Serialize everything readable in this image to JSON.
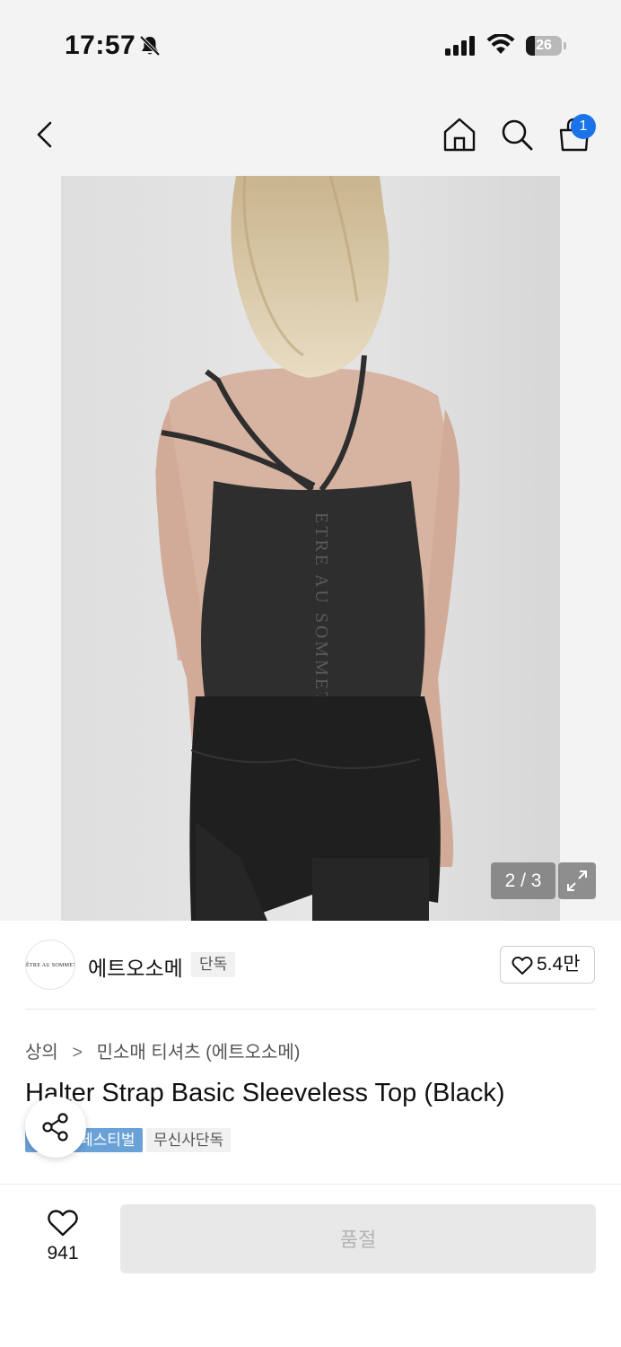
{
  "status_bar": {
    "time": "17:57",
    "battery_level": "26",
    "battery_fraction": 0.26
  },
  "nav": {
    "cart_count": "1"
  },
  "gallery": {
    "counter": "2 / 3",
    "print_text": "ETRE AU SOMMET"
  },
  "brand": {
    "logo_text": "ÊTRE AU SOMMET",
    "name": "에트오소메",
    "exclusive_tag": "단독",
    "like_count": "5.4만"
  },
  "product": {
    "breadcrumb": [
      "상의",
      "민소매 티셔츠 (에트오소메)"
    ],
    "breadcrumb_separator": ">",
    "title": "Halter Strap Basic Sleeveless Top (Black)",
    "tags": [
      "페스티벌",
      "무신사단독"
    ]
  },
  "bottom_bar": {
    "wish_count": "941",
    "buy_label": "품절"
  },
  "colors": {
    "accent_blue": "#1a73e8",
    "festival_tag": "#6aa2d8",
    "disabled_button": "#e8e8e8"
  },
  "icons": [
    "bell-muted-icon",
    "signal-icon",
    "wifi-icon",
    "battery-icon",
    "back-icon",
    "home-icon",
    "search-icon",
    "cart-icon",
    "expand-icon",
    "heart-icon",
    "share-icon"
  ]
}
